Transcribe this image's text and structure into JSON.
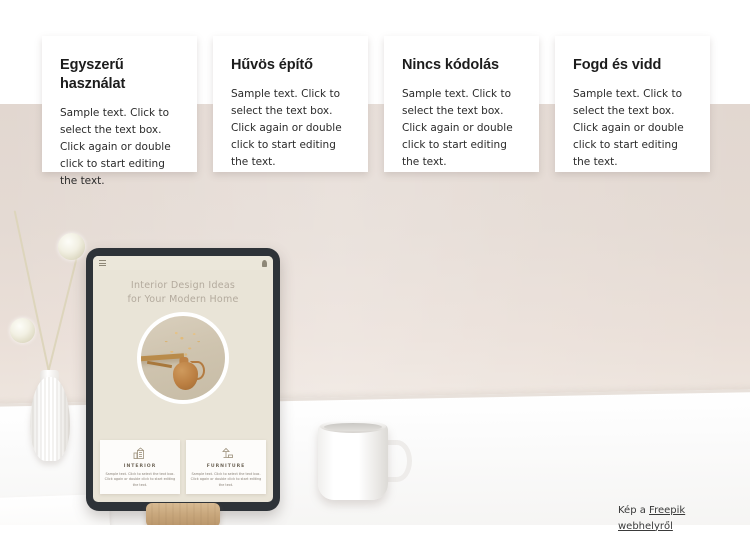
{
  "feature_cards": [
    {
      "title": "Egyszerű használat",
      "text": "Sample text. Click to select the text box. Click again or double click to start editing the text."
    },
    {
      "title": "Hűvös építő",
      "text": "Sample text. Click to select the text box. Click again or double click to start editing the text."
    },
    {
      "title": "Nincs kódolás",
      "text": "Sample text. Click to select the text box. Click again or double click to start editing the text."
    },
    {
      "title": "Fogd és vidd",
      "text": "Sample text. Click to select the text box. Click again or double click to start editing the text."
    }
  ],
  "tablet": {
    "hero_line1": "Interior Design Ideas",
    "hero_line2": "for Your Modern Home",
    "menu_icon": "hamburger-menu-icon",
    "notification_icon": "bell-icon",
    "mini_cards": [
      {
        "icon": "interior-house-icon",
        "label": "INTERIOR",
        "text": "Sample text. Click to select the text box. Click again or double click to start editing the text."
      },
      {
        "icon": "furniture-lamp-icon",
        "label": "FURNITURE",
        "text": "Sample text. Click to select the text box. Click again or double click to start editing the text."
      }
    ]
  },
  "attribution": {
    "prefix": "Kép a ",
    "link_text": "Freepik webhelyről"
  },
  "colors": {
    "card_background": "#ffffff",
    "title_color": "#1c1c1c",
    "body_color": "#2a2a2a",
    "wall_beige": "#e4dad3",
    "desk_white": "#ffffff",
    "tablet_bezel": "#2e3338",
    "tablet_screen": "#e9e4d7",
    "stand_wood": "#c9a87d"
  },
  "scene_objects": {
    "vase": "white-ribbed-vase",
    "flowers": "dried-allium-flowers",
    "mug": "white-ceramic-mug",
    "stand": "wooden-tablet-stand",
    "device": "tablet"
  }
}
